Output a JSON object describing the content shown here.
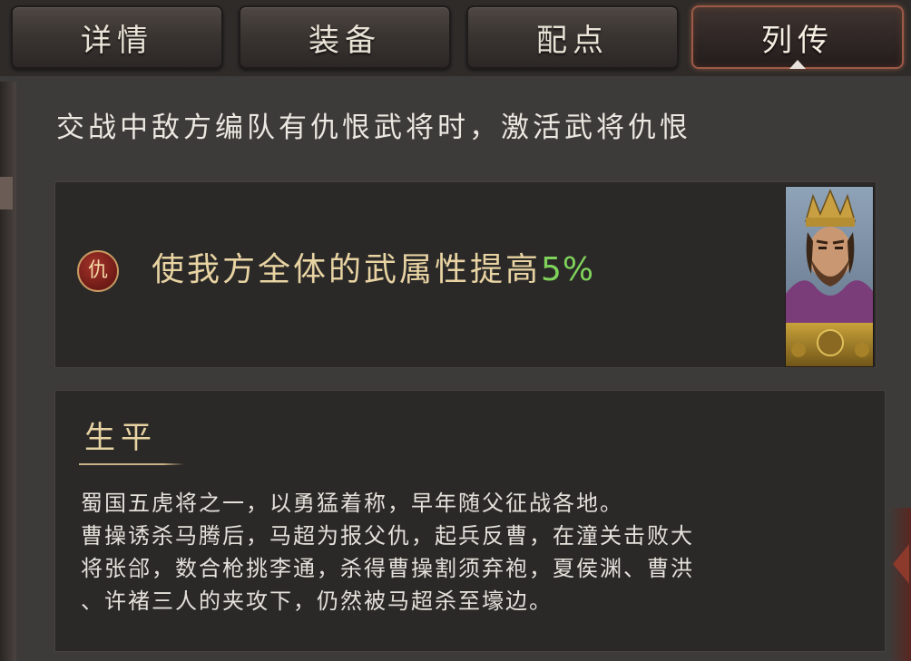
{
  "tabs": [
    {
      "label": "详情",
      "active": false
    },
    {
      "label": "装备",
      "active": false
    },
    {
      "label": "配点",
      "active": false
    },
    {
      "label": "列传",
      "active": true
    }
  ],
  "intro": {
    "text": "交战中敌方编队有仇恨武将时，激活武将仇恨"
  },
  "effect": {
    "badge_char": "仇",
    "text_prefix": "使我方全体的武属性提高",
    "value": "5%",
    "colors": {
      "text": "#e8d3a2",
      "value": "#7fd25a",
      "badge": "#8b1f1a"
    }
  },
  "portrait": {
    "icon": "general-portrait"
  },
  "biography": {
    "title": "生平",
    "lines": [
      "蜀国五虎将之一，以勇猛着称，早年随父征战各地。",
      "曹操诱杀马腾后，马超为报父仇，起兵反曹，在潼关击败大",
      "将张郃，数合枪挑李通，杀得曹操割须弃袍，夏侯渊、曹洪",
      "、许褚三人的夹攻下，仍然被马超杀至壕边。"
    ]
  }
}
